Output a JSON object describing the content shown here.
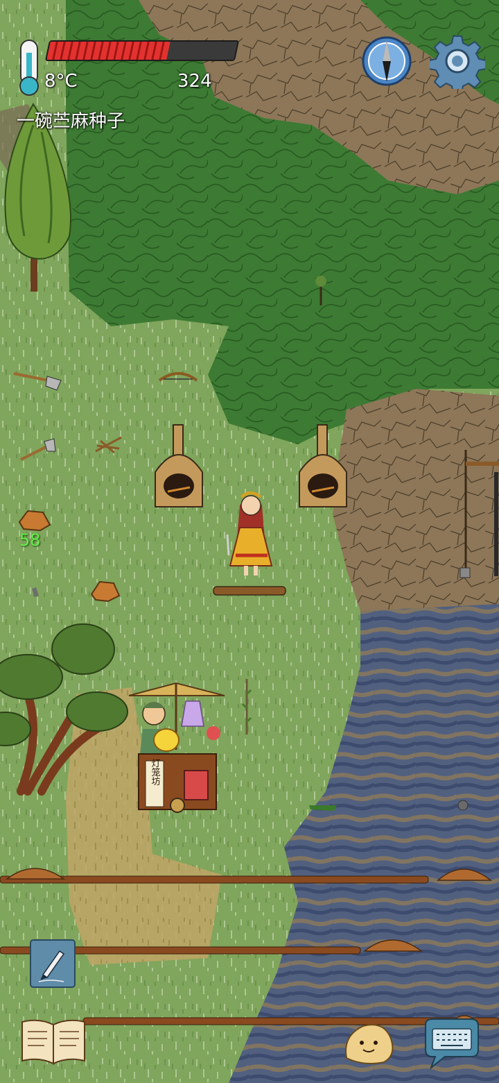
{
  "hud": {
    "temperature": "8°C",
    "score": "324",
    "held_item": "一碗苎麻种子",
    "health_fraction": 0.64,
    "floater_number": "58"
  },
  "controls": {
    "compass_icon": "compass-icon",
    "settings_icon": "gear-icon",
    "note_icon": "pencil-icon",
    "recipe_book_icon": "open-book-icon",
    "emote_icon": "smiley-face-icon",
    "chat_icon": "keyboard-speech-bubble-icon"
  },
  "shop_sign": "灯笼坊",
  "colors": {
    "grass": "#7ea35a",
    "forest": "#3f7a34",
    "dirt": "#8a7355",
    "water": "#4f5e80",
    "health_red": "#e2322f",
    "floater_green": "#62ef4a"
  }
}
